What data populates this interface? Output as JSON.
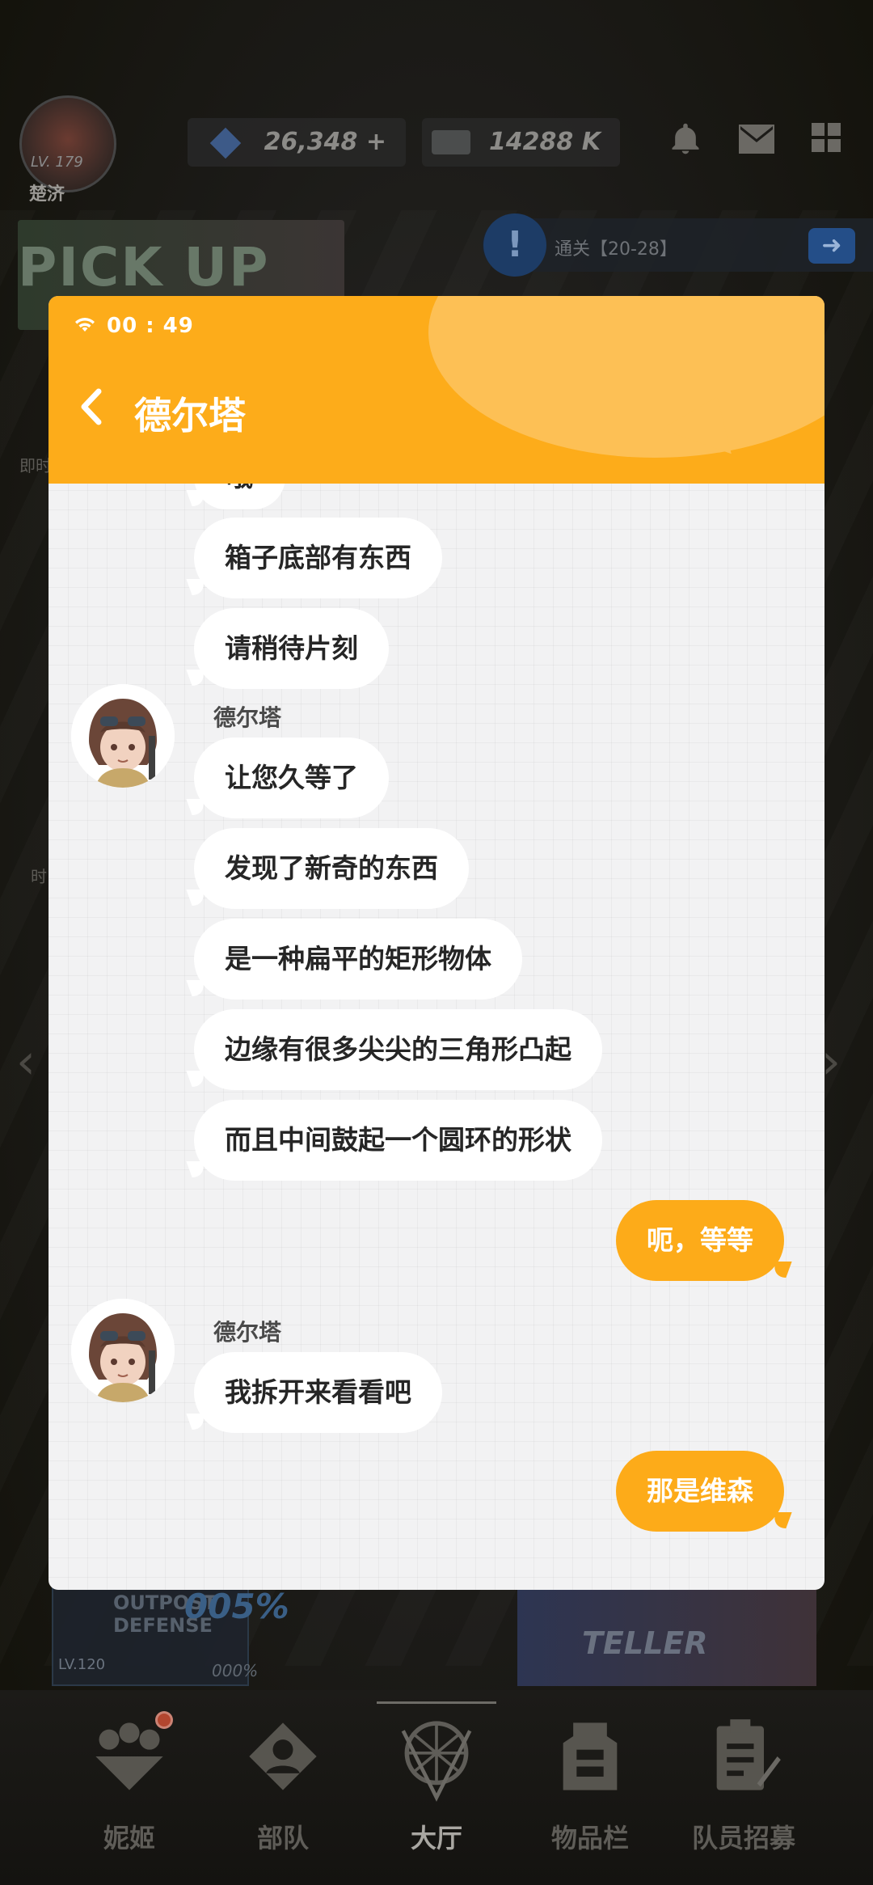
{
  "player": {
    "level": "LV. 179",
    "name": "楚济"
  },
  "currencies": {
    "gems": "26,348 +",
    "credits": "14288 K"
  },
  "banner": {
    "pickup": "PICK UP",
    "mission": "通关【20-28】"
  },
  "side_labels": {
    "left_top": "即时",
    "left_bottom": "时"
  },
  "outpost": {
    "title_line1": "OUTPOST",
    "title_line2": "DEFENSE",
    "percent": "005%",
    "level": "LV.120",
    "percent_small": "000%"
  },
  "event_banner": {
    "text": "TELLER"
  },
  "nav": {
    "items": [
      {
        "label": "妮姬",
        "icon": "nikke-icon"
      },
      {
        "label": "部队",
        "icon": "squad-icon"
      },
      {
        "label": "大厅",
        "icon": "lobby-icon"
      },
      {
        "label": "物品栏",
        "icon": "inventory-icon"
      },
      {
        "label": "队员招募",
        "icon": "recruit-icon"
      }
    ],
    "active": "大厅"
  },
  "chat": {
    "status_time": "00 : 49",
    "title": "德尔塔",
    "accent_color": "#fdac1a",
    "messages": [
      {
        "side": "left",
        "text": "哦"
      },
      {
        "side": "left",
        "text": "箱子底部有东西"
      },
      {
        "side": "left",
        "text": "请稍待片刻"
      },
      {
        "side": "left",
        "sender": "德尔塔",
        "text": "让您久等了"
      },
      {
        "side": "left",
        "text": "发现了新奇的东西"
      },
      {
        "side": "left",
        "text": "是一种扁平的矩形物体"
      },
      {
        "side": "left",
        "text": "边缘有很多尖尖的三角形凸起"
      },
      {
        "side": "left",
        "text": "而且中间鼓起一个圆环的形状"
      },
      {
        "side": "right",
        "text": "呃，等等"
      },
      {
        "side": "left",
        "sender": "德尔塔",
        "text": "我拆开来看看吧"
      },
      {
        "side": "right",
        "text": "那是维森"
      }
    ]
  }
}
